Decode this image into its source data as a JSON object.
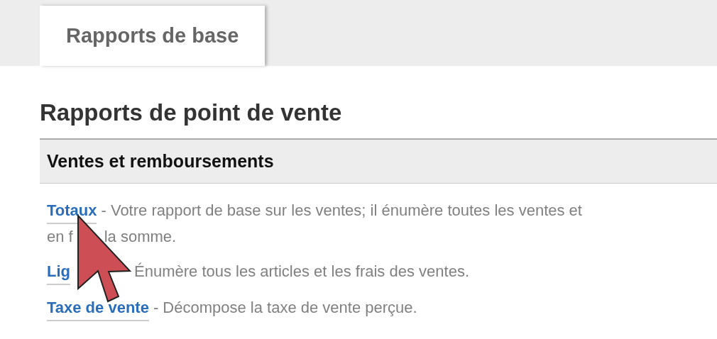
{
  "tabs": [
    {
      "label": "Rapports de base",
      "selected": true
    }
  ],
  "heading": "Rapports de point de vente",
  "section": {
    "title": "Ventes et remboursements",
    "reports": [
      {
        "link": "Totaux",
        "after_link": [
          "- Votre rapport de base sur les ventes; il énumère toutes les ventes et"
        ],
        "next_line": [
          "en f",
          "la somme."
        ]
      },
      {
        "link": "Lig",
        "after_link": [
          "Énumère tous les articles et les frais des ventes."
        ]
      },
      {
        "link": "Taxe de vente",
        "after_link": [
          "- Décompose la taxe de vente perçue."
        ]
      }
    ]
  }
}
